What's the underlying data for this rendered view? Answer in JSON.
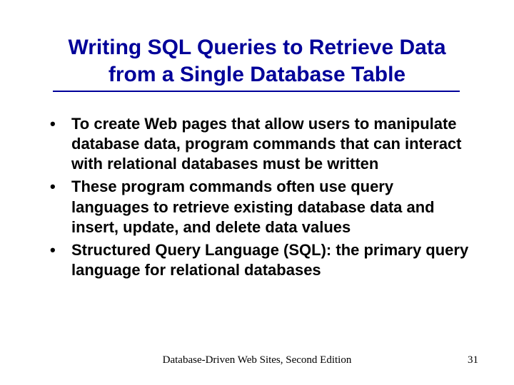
{
  "title_line1": "Writing SQL Queries to Retrieve Data",
  "title_line2": "from a Single Database Table",
  "bullets": [
    "To create Web pages that allow users to manipulate database data, program commands that can interact with relational databases must be written",
    "These program commands often use query languages to retrieve existing database data and insert, update, and delete data values",
    "Structured Query Language (SQL): the primary query language for relational databases"
  ],
  "footer_center": "Database-Driven Web Sites, Second Edition",
  "footer_right": "31"
}
